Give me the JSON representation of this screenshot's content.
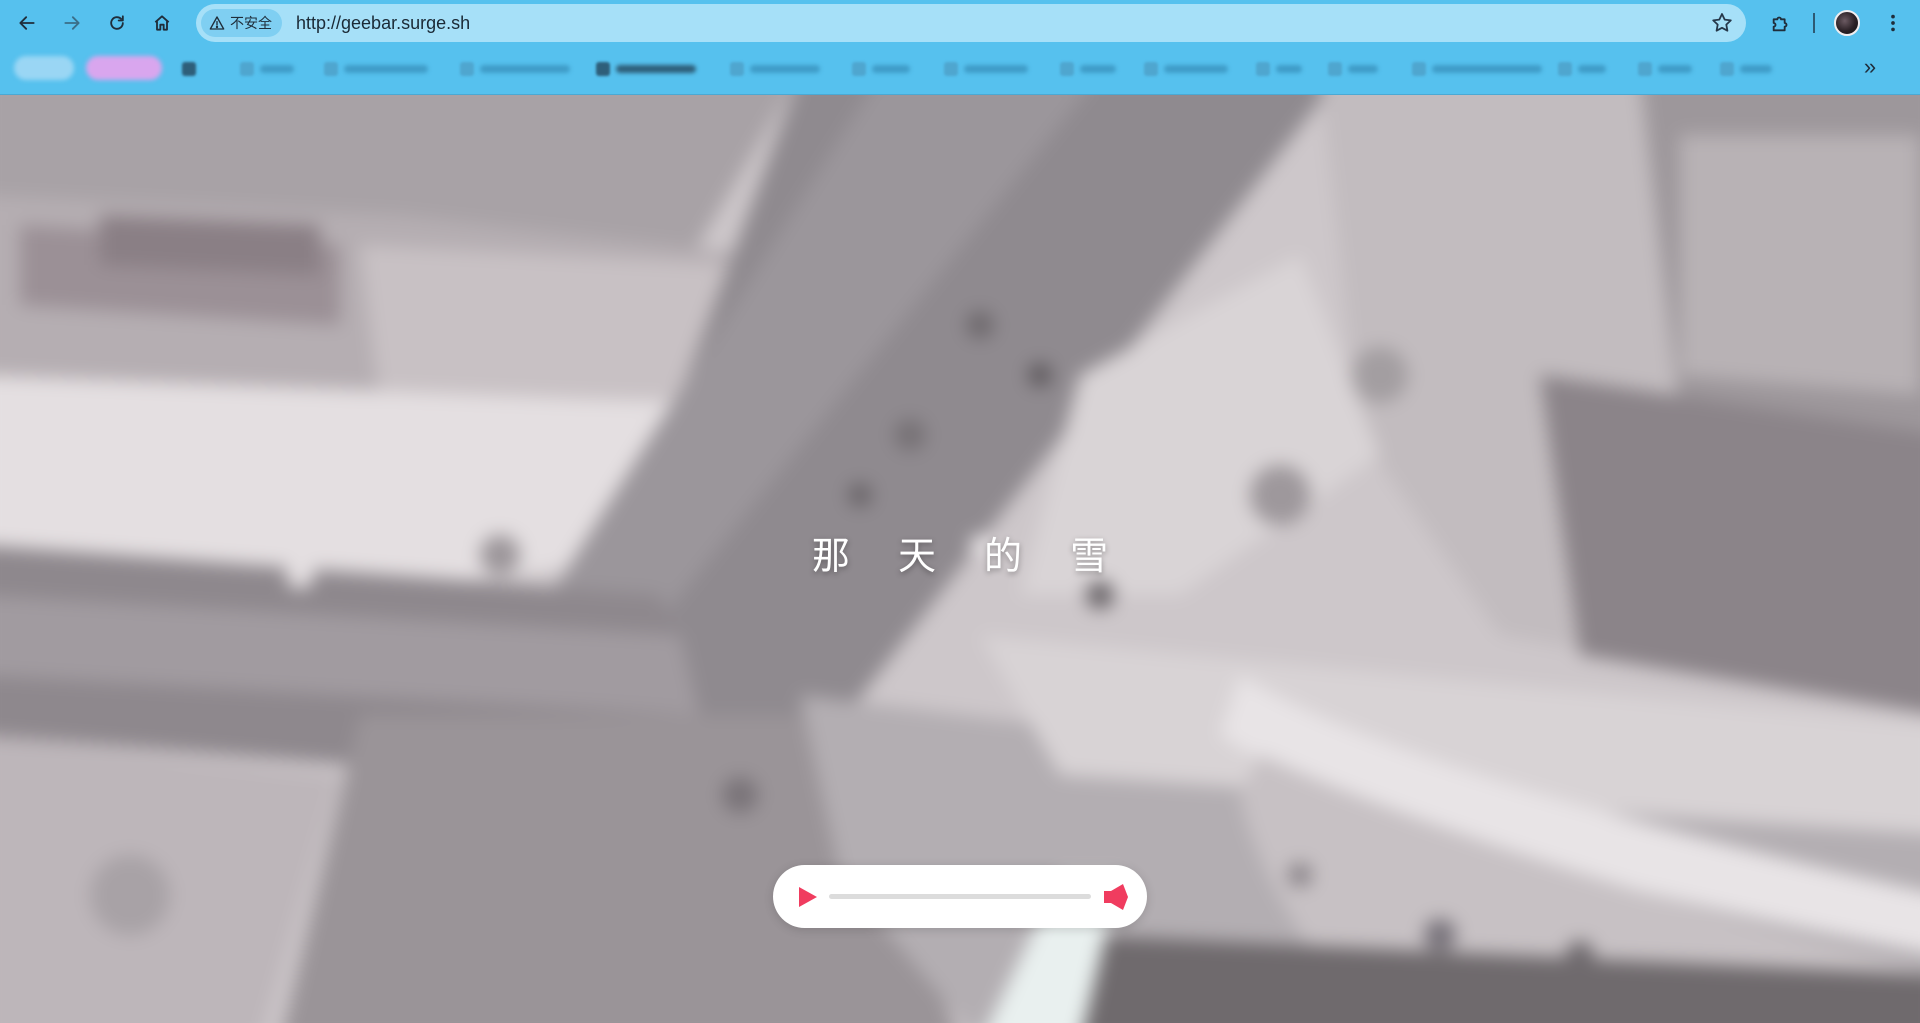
{
  "browser": {
    "security_label": "不安全",
    "url": "http://geebar.surge.sh",
    "bookmarks_overflow": "»",
    "bookmark_count": 18
  },
  "page": {
    "title": "那 天 的 雪",
    "player": {
      "progress": 0.0,
      "accent_color": "#f03c5f",
      "track_color": "#dcdcdc"
    }
  },
  "icons": {
    "back": "back-arrow-icon",
    "forward": "forward-arrow-icon",
    "reload": "reload-icon",
    "home": "home-icon",
    "warning": "warning-icon",
    "star": "star-icon",
    "extensions": "puzzle-icon",
    "menu": "kebab-menu-icon",
    "play": "play-icon",
    "volume": "speaker-icon"
  }
}
